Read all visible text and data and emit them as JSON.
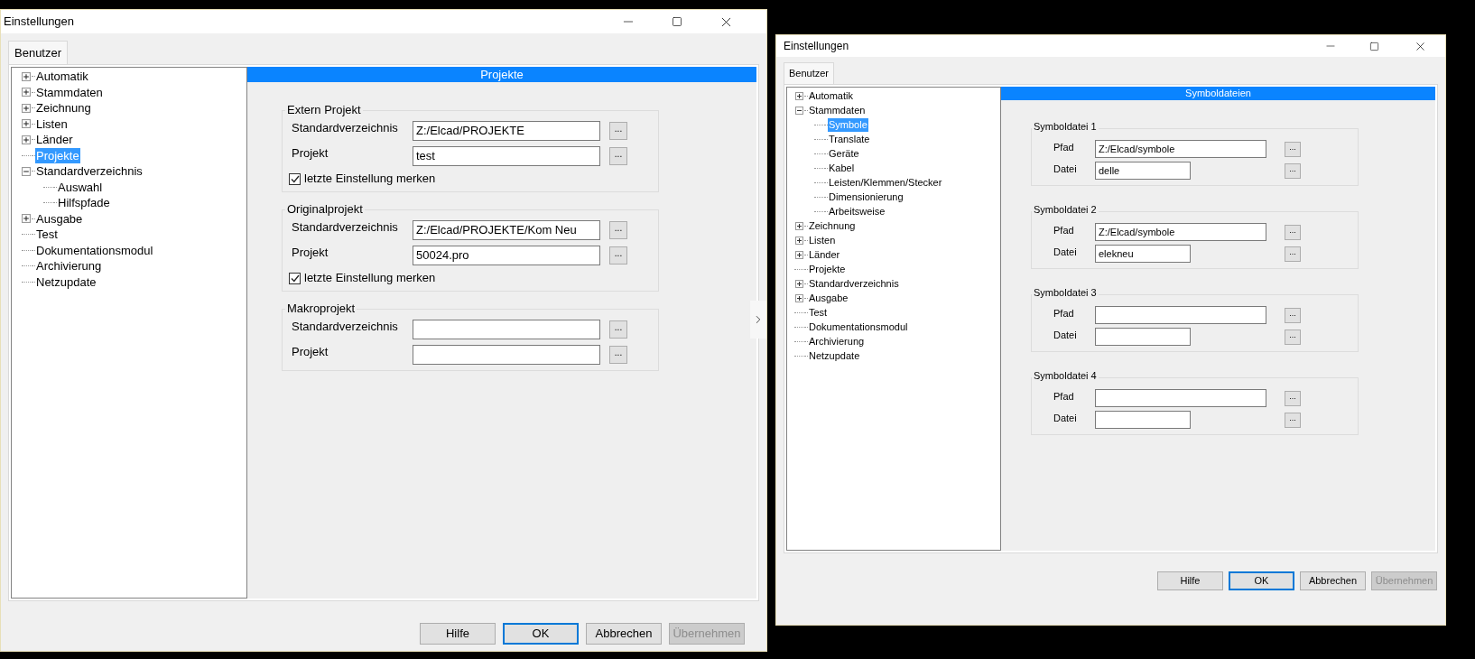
{
  "windows": [
    {
      "title": "Einstellungen",
      "tab": {
        "label": "Benutzer",
        "selected": true
      },
      "side_handle": true,
      "tree": [
        {
          "label": "Automatik",
          "expanded": false,
          "selected": false
        },
        {
          "label": "Stammdaten",
          "expanded": false,
          "selected": false
        },
        {
          "label": "Zeichnung",
          "expanded": false,
          "selected": false
        },
        {
          "label": "Listen",
          "expanded": false,
          "selected": false
        },
        {
          "label": "Länder",
          "expanded": false,
          "selected": false
        },
        {
          "label": "Projekte",
          "selected": true
        },
        {
          "label": "Standardverzeichnis",
          "expanded": true,
          "selected": false,
          "children": [
            {
              "label": "Auswahl",
              "selected": false
            },
            {
              "label": "Hilfspfade",
              "selected": false
            }
          ]
        },
        {
          "label": "Ausgabe",
          "expanded": false,
          "selected": false
        },
        {
          "label": "Test",
          "selected": false
        },
        {
          "label": "Dokumentationsmodul",
          "selected": false
        },
        {
          "label": "Archivierung",
          "selected": false
        },
        {
          "label": "Netzupdate",
          "selected": false
        }
      ],
      "header": "Projekte",
      "groups": [
        {
          "title": "Extern Projekt",
          "fields": [
            {
              "label": "Standardverzeichnis",
              "value": "Z:/Elcad/PROJEKTE",
              "kind": "wide",
              "browse": "..."
            },
            {
              "label": "Projekt",
              "value": "test",
              "kind": "wide",
              "browse": "..."
            }
          ],
          "checkbox": {
            "label": "letzte Einstellung merken",
            "checked": true
          }
        },
        {
          "title": "Originalprojekt",
          "fields": [
            {
              "label": "Standardverzeichnis",
              "value": "Z:/Elcad/PROJEKTE/Kom Neu",
              "kind": "wide",
              "browse": "..."
            },
            {
              "label": "Projekt",
              "value": "50024.pro",
              "kind": "wide",
              "browse": "..."
            }
          ],
          "checkbox": {
            "label": "letzte Einstellung merken",
            "checked": true
          }
        },
        {
          "title": "Makroprojekt",
          "fields": [
            {
              "label": "Standardverzeichnis",
              "kind": "wide",
              "browse": "..."
            },
            {
              "label": "Projekt",
              "kind": "wide",
              "browse": "..."
            }
          ]
        }
      ],
      "buttons": [
        {
          "label": "Hilfe",
          "default": false,
          "disabled": false
        },
        {
          "label": "OK",
          "default": true,
          "disabled": false
        },
        {
          "label": "Abbrechen",
          "default": false,
          "disabled": false
        },
        {
          "label": "Übernehmen",
          "default": false,
          "disabled": true
        }
      ]
    },
    {
      "title": "Einstellungen",
      "tab": {
        "label": "Benutzer",
        "selected": true
      },
      "side_handle": false,
      "tree": [
        {
          "label": "Automatik",
          "expanded": false,
          "selected": false
        },
        {
          "label": "Stammdaten",
          "expanded": true,
          "selected": false,
          "children": [
            {
              "label": "Symbole",
              "selected": true
            },
            {
              "label": "Translate",
              "selected": false
            },
            {
              "label": "Geräte",
              "selected": false
            },
            {
              "label": "Kabel",
              "selected": false
            },
            {
              "label": "Leisten/Klemmen/Stecker",
              "selected": false
            },
            {
              "label": "Dimensionierung",
              "selected": false
            },
            {
              "label": "Arbeitsweise",
              "selected": false
            }
          ]
        },
        {
          "label": "Zeichnung",
          "expanded": false,
          "selected": false
        },
        {
          "label": "Listen",
          "expanded": false,
          "selected": false
        },
        {
          "label": "Länder",
          "expanded": false,
          "selected": false
        },
        {
          "label": "Projekte",
          "selected": false
        },
        {
          "label": "Standardverzeichnis",
          "expanded": false,
          "selected": false
        },
        {
          "label": "Ausgabe",
          "expanded": false,
          "selected": false
        },
        {
          "label": "Test",
          "selected": false
        },
        {
          "label": "Dokumentationsmodul",
          "selected": false
        },
        {
          "label": "Archivierung",
          "selected": false
        },
        {
          "label": "Netzupdate",
          "selected": false
        }
      ],
      "header": "Symboldateien",
      "groups": [
        {
          "title": "Symboldatei 1",
          "fields": [
            {
              "label": "Pfad",
              "value": "Z:/Elcad/symbole",
              "kind": "wide",
              "browse": "..."
            },
            {
              "label": "Datei",
              "value": "delle",
              "kind": "short",
              "browse": "..."
            }
          ]
        },
        {
          "title": "Symboldatei 2",
          "fields": [
            {
              "label": "Pfad",
              "value": "Z:/Elcad/symbole",
              "kind": "wide",
              "browse": "..."
            },
            {
              "label": "Datei",
              "value": "elekneu",
              "kind": "short",
              "browse": "..."
            }
          ]
        },
        {
          "title": "Symboldatei 3",
          "fields": [
            {
              "label": "Pfad",
              "kind": "wide",
              "browse": "..."
            },
            {
              "label": "Datei",
              "kind": "short",
              "browse": "..."
            }
          ]
        },
        {
          "title": "Symboldatei 4",
          "fields": [
            {
              "label": "Pfad",
              "kind": "wide",
              "browse": "..."
            },
            {
              "label": "Datei",
              "kind": "short",
              "browse": "..."
            }
          ]
        }
      ],
      "buttons": [
        {
          "label": "Hilfe",
          "default": false,
          "disabled": false
        },
        {
          "label": "OK",
          "default": true,
          "disabled": false
        },
        {
          "label": "Abbrechen",
          "default": false,
          "disabled": false
        },
        {
          "label": "Übernehmen",
          "default": false,
          "disabled": true
        }
      ]
    }
  ]
}
